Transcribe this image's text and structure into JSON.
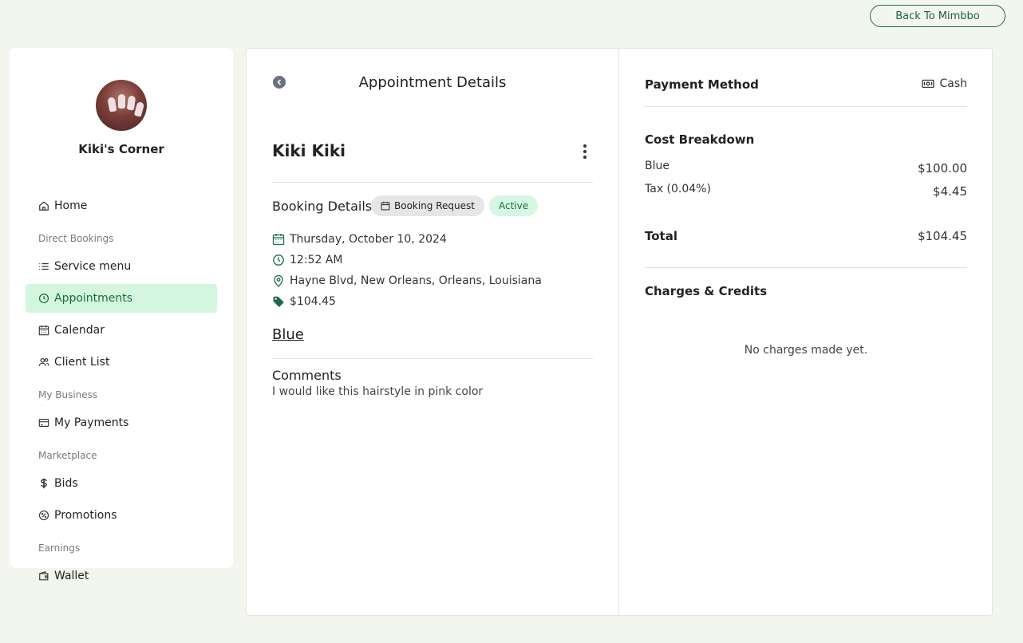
{
  "header": {
    "back_label": "Back To Mimbbo"
  },
  "sidebar": {
    "business_name": "Kiki's Corner",
    "items": [
      {
        "label": "Home",
        "icon": "home-icon"
      },
      {
        "label": "Service menu",
        "icon": "list-icon"
      },
      {
        "label": "Appointments",
        "icon": "clock-icon",
        "active": true
      },
      {
        "label": "Calendar",
        "icon": "calendar-icon"
      },
      {
        "label": "Client List",
        "icon": "users-icon"
      },
      {
        "label": "My Payments",
        "icon": "card-icon"
      },
      {
        "label": "Bids",
        "icon": "dollar-icon"
      },
      {
        "label": "Promotions",
        "icon": "badge-percent-icon"
      },
      {
        "label": "Wallet",
        "icon": "wallet-icon"
      }
    ],
    "sections": [
      "Direct Bookings",
      "My Business",
      "Marketplace",
      "Earnings"
    ]
  },
  "appointment": {
    "title": "Appointment Details",
    "client_name": "Kiki Kiki",
    "booking_label": "Booking Details",
    "booking_type": "Booking Request",
    "status": "Active",
    "date": "Thursday, October 10, 2024",
    "time": "12:52 AM",
    "location": "Hayne Blvd, New Orleans, Orleans, Louisiana",
    "price": "$104.45",
    "service": "Blue",
    "comments_label": "Comments",
    "comments": "I would like this hairstyle in pink color"
  },
  "payment": {
    "method_label": "Payment Method",
    "method": "Cash",
    "breakdown_label": "Cost Breakdown",
    "lines": [
      {
        "label": "Blue",
        "amount": "$100.00"
      },
      {
        "label": "Tax (0.04%)",
        "amount": "$4.45"
      }
    ],
    "total_label": "Total",
    "total": "$104.45",
    "charges_label": "Charges & Credits",
    "no_charges": "No charges made yet."
  },
  "colors": {
    "accent": "#1e6b4a",
    "active_bg": "#d4f6df",
    "page_bg": "#f3f6ef"
  }
}
